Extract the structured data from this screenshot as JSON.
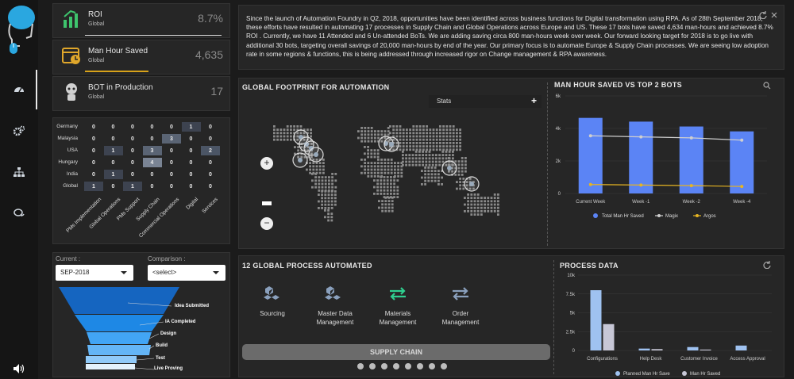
{
  "kpis": [
    {
      "label": "ROI",
      "sub": "Global",
      "value": "8.7%"
    },
    {
      "label": "Man Hour Saved",
      "sub": "Global",
      "value": "4,635"
    },
    {
      "label": "BOT in Production",
      "sub": "Global",
      "value": "17"
    }
  ],
  "heatmap": {
    "rows": [
      "Germany",
      "Malaysia",
      "USA",
      "Hungary",
      "India",
      "Global"
    ],
    "cols": [
      "PMs Implementation",
      "Global Operations",
      "PMs Support",
      "Supply Chain",
      "Commercial Operations",
      "Digital",
      "Services"
    ],
    "values": [
      [
        0,
        0,
        0,
        0,
        0,
        1,
        0
      ],
      [
        0,
        0,
        0,
        0,
        3,
        0,
        0
      ],
      [
        0,
        1,
        0,
        3,
        0,
        0,
        2
      ],
      [
        0,
        0,
        0,
        4,
        0,
        0,
        0
      ],
      [
        0,
        1,
        0,
        0,
        0,
        0,
        0
      ],
      [
        1,
        0,
        1,
        0,
        0,
        0,
        0
      ]
    ]
  },
  "compare": {
    "current_label": "Current :",
    "current_value": "SEP-2018",
    "comparison_label": "Comparison :",
    "comparison_value": "<select>"
  },
  "funnel": {
    "stages": [
      "Idea Submitted",
      "IA Completed",
      "Design",
      "Build",
      "Test",
      "Live Proving"
    ],
    "colors": [
      "#1565c0",
      "#1e88e5",
      "#42a5f5",
      "#64b5f6",
      "#90caf9",
      "#e3f2fd"
    ]
  },
  "info": {
    "text": "Since the launch of Automation Foundry in Q2, 2018, opportunities have been identified across business functions for Digital transformation using RPA. As of 28th September 2018, these efforts have resulted in automating 17 processes in Supply Chain and Global Operations across Europe and US. These 17 bots have saved 4,634 man-hours and achieved 8.7% ROI . Currently, we have 11 Attended and 6 Un-attended BoTs. We are adding saving circa 800 man-hours week over week. Our forward looking target for 2018 is to go live with additional 30 bots, targeting overall savings of 20,000 man-hours by end of the year. Our primary focus is to automate Europe & Supply Chain processes. We are seeing low adoption rate in some regions & functions, this is being addressed through increased rigor on Change management & RPA awareness."
  },
  "map": {
    "title": "GLOBAL FOOTPRINT FOR AUTOMATION",
    "stats_label": "Stats",
    "zoom_in": "+",
    "zoom_out": "−"
  },
  "chart_data": [
    {
      "type": "bar",
      "title": "MAN HOUR SAVED VS TOP 2 BOTS",
      "categories": [
        "Current Week",
        "Week -1",
        "Week -2",
        "Week -4"
      ],
      "ylim": [
        0,
        6000
      ],
      "yticks": [
        "0",
        "2k",
        "4k",
        "6k"
      ],
      "series": [
        {
          "name": "Total Man Hr Saved",
          "kind": "bar",
          "color": "#5b84f5",
          "values": [
            4650,
            4420,
            4120,
            3820
          ]
        },
        {
          "name": "Magix",
          "kind": "line",
          "color": "#cfcfcf",
          "values": [
            3550,
            3480,
            3420,
            3280
          ]
        },
        {
          "name": "Argos",
          "kind": "line",
          "color": "#e6b422",
          "values": [
            550,
            520,
            480,
            430
          ]
        }
      ],
      "legend": "bottom"
    },
    {
      "type": "bar",
      "title": "PROCESS DATA",
      "categories": [
        "Configurations",
        "Help Desk",
        "Customer Invoice",
        "Access Approval"
      ],
      "ylim": [
        0,
        10000
      ],
      "yticks": [
        "0",
        "2.5k",
        "5k",
        "7.5k",
        "10k"
      ],
      "series": [
        {
          "name": "Planned Man Hr Save",
          "color": "#9fc2f0",
          "values": [
            8000,
            250,
            450,
            650
          ]
        },
        {
          "name": "Man Hr Saved",
          "color": "#c7c7d6",
          "values": [
            3500,
            180,
            120,
            0
          ]
        }
      ],
      "legend": "bottom"
    }
  ],
  "process": {
    "title": "12 GLOBAL PROCESS AUTOMATED",
    "items": [
      {
        "line1": "Sourcing",
        "line2": ""
      },
      {
        "line1": "Master Data",
        "line2": "Management"
      },
      {
        "line1": "Materials",
        "line2": "Management"
      },
      {
        "line1": "Order",
        "line2": "Management"
      }
    ],
    "button": "SUPPLY CHAIN"
  }
}
